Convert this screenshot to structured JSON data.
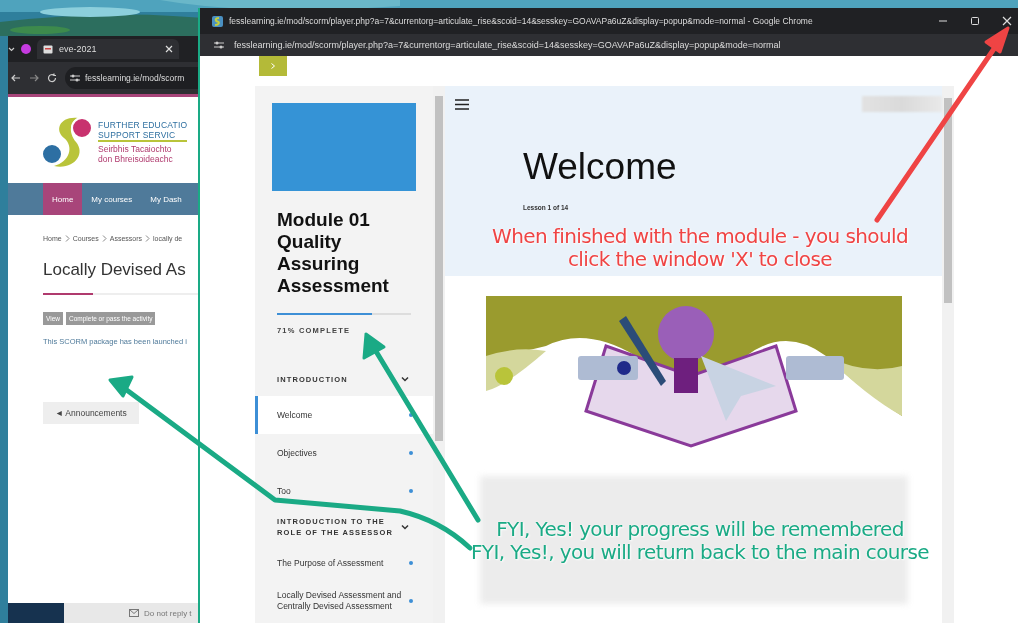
{
  "back_window": {
    "tabs": [
      {
        "label": "eve-2021",
        "selected": true
      }
    ],
    "address": "fesslearning.ie/mod/scorm",
    "logo_lines": [
      "FURTHER EDUCATIO",
      "SUPPORT SERVIC",
      "Seirbhis Tacaiochto",
      "don Bhreisoideachc"
    ],
    "nav": [
      {
        "label": "Home",
        "selected": true
      },
      {
        "label": "My courses",
        "selected": false
      },
      {
        "label": "My Dash",
        "selected": false
      }
    ],
    "breadcrumb": [
      "Home",
      "Courses",
      "Assessors",
      "locally de"
    ],
    "heading": "Locally Devised As",
    "badges": [
      "View",
      "Complete or pass the activity"
    ],
    "notice": "This SCORM package has been launched i",
    "prev_button": "◄ Announcements",
    "footer": "Do not reply t"
  },
  "popup": {
    "title": "fesslearning.ie/mod/scorm/player.php?a=7&currentorg=articulate_rise&scoid=14&sesskey=GOAVAPa6uZ&display=popup&mode=normal - Google Chrome",
    "address": "fesslearning.ie/mod/scorm/player.php?a=7&currentorg=articulate_rise&scoid=14&sesskey=GOAVAPa6uZ&display=popup&mode=normal",
    "sidebar": {
      "title": "Module 01 Quality Assuring Assessment",
      "progress": {
        "level": 0.71,
        "label": "71% COMPLETE"
      },
      "sections": [
        {
          "title": "INTRODUCTION",
          "expanded": true,
          "lessons": [
            {
              "label": "Welcome",
              "selected": true
            },
            {
              "label": "Objectives",
              "selected": false
            },
            {
              "label": "Too",
              "selected": false
            }
          ]
        },
        {
          "title": "INTRODUCTION TO THE ROLE OF THE ASSESSOR",
          "expanded": true,
          "lessons": [
            {
              "label": "The Purpose of Assessment",
              "selected": false
            },
            {
              "label": "Locally Devised Assessment and Centrally Devised Assessment",
              "selected": false
            }
          ]
        }
      ]
    },
    "lesson": {
      "title": "Welcome",
      "counter": "Lesson 1 of 14"
    }
  },
  "annotations": [
    {
      "kind": "red",
      "text": "When finished with the module - you should click the window 'X' to close"
    },
    {
      "kind": "green",
      "text": "FYI, Yes! your progress will be remembered"
    },
    {
      "kind": "green",
      "text": "FYI, Yes!, you will return back to the main course"
    }
  ]
}
